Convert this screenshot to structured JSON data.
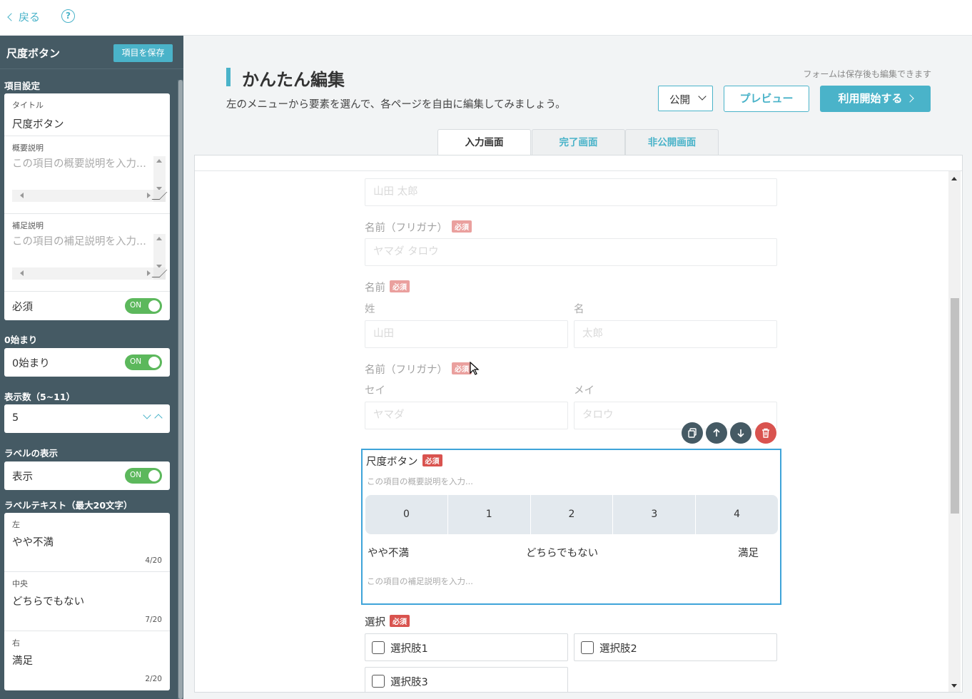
{
  "topbar": {
    "back_label": "戻る",
    "help_label": "?"
  },
  "sidebar": {
    "title": "尺度ボタン",
    "save_label": "項目を保存",
    "item_settings_label": "項目設定",
    "title_field": {
      "label": "タイトル",
      "value": "尺度ボタン"
    },
    "summary_field": {
      "label": "概要説明",
      "placeholder": "この項目の概要説明を入力..."
    },
    "supplement_field": {
      "label": "補足説明",
      "placeholder": "この項目の補足説明を入力..."
    },
    "required": {
      "label": "必須",
      "toggle": "ON"
    },
    "zero_start_section": "0始まり",
    "zero_start": {
      "label": "0始まり",
      "toggle": "ON"
    },
    "count_section": "表示数（5~11）",
    "count_value": "5",
    "label_display_section": "ラベルの表示",
    "label_display": {
      "label": "表示",
      "toggle": "ON"
    },
    "label_text_section": "ラベルテキスト（最大20文字）",
    "label_left": {
      "label": "左",
      "value": "やや不満",
      "counter": "4/20"
    },
    "label_center": {
      "label": "中央",
      "value": "どちらでもない",
      "counter": "7/20"
    },
    "label_right": {
      "label": "右",
      "value": "満足",
      "counter": "2/20"
    }
  },
  "main": {
    "heading": "かんたん編集",
    "subtext": "左のメニューから要素を選んで、各ページを自由に編集してみましょう。",
    "note": "フォームは保存後も編集できます",
    "publish_select": "公開",
    "preview_label": "プレビュー",
    "start_label": "利用開始する",
    "tabs": [
      {
        "label": "入力画面"
      },
      {
        "label": "完了画面"
      },
      {
        "label": "非公開画面"
      }
    ]
  },
  "form": {
    "name_placeholder": "山田 太郎",
    "kana_label": "名前（フリガナ）",
    "kana_placeholder": "ヤマダ タロウ",
    "required_badge": "必須",
    "name2_label": "名前",
    "sei_label": "姓",
    "mei_label": "名",
    "sei_placeholder": "山田",
    "mei_placeholder": "太郎",
    "kana2_label": "名前（フリガナ）",
    "sei_kana_label": "セイ",
    "mei_kana_label": "メイ",
    "sei_kana_placeholder": "ヤマダ",
    "mei_kana_placeholder": "タロウ",
    "scale": {
      "title": "尺度ボタン",
      "desc_placeholder": "この項目の概要説明を入力...",
      "options": [
        "0",
        "1",
        "2",
        "3",
        "4"
      ],
      "label_left": "やや不満",
      "label_center": "どちらでもない",
      "label_right": "満足",
      "sub_placeholder": "この項目の補足説明を入力..."
    },
    "select": {
      "label": "選択",
      "options": [
        "選択肢1",
        "選択肢2",
        "選択肢3"
      ]
    }
  },
  "colors": {
    "accent": "#4ab3c9",
    "sidebar": "#455a64",
    "required": "#d9534f",
    "toggle_on": "#5cb85c",
    "selected_border": "#3fa4d9"
  }
}
